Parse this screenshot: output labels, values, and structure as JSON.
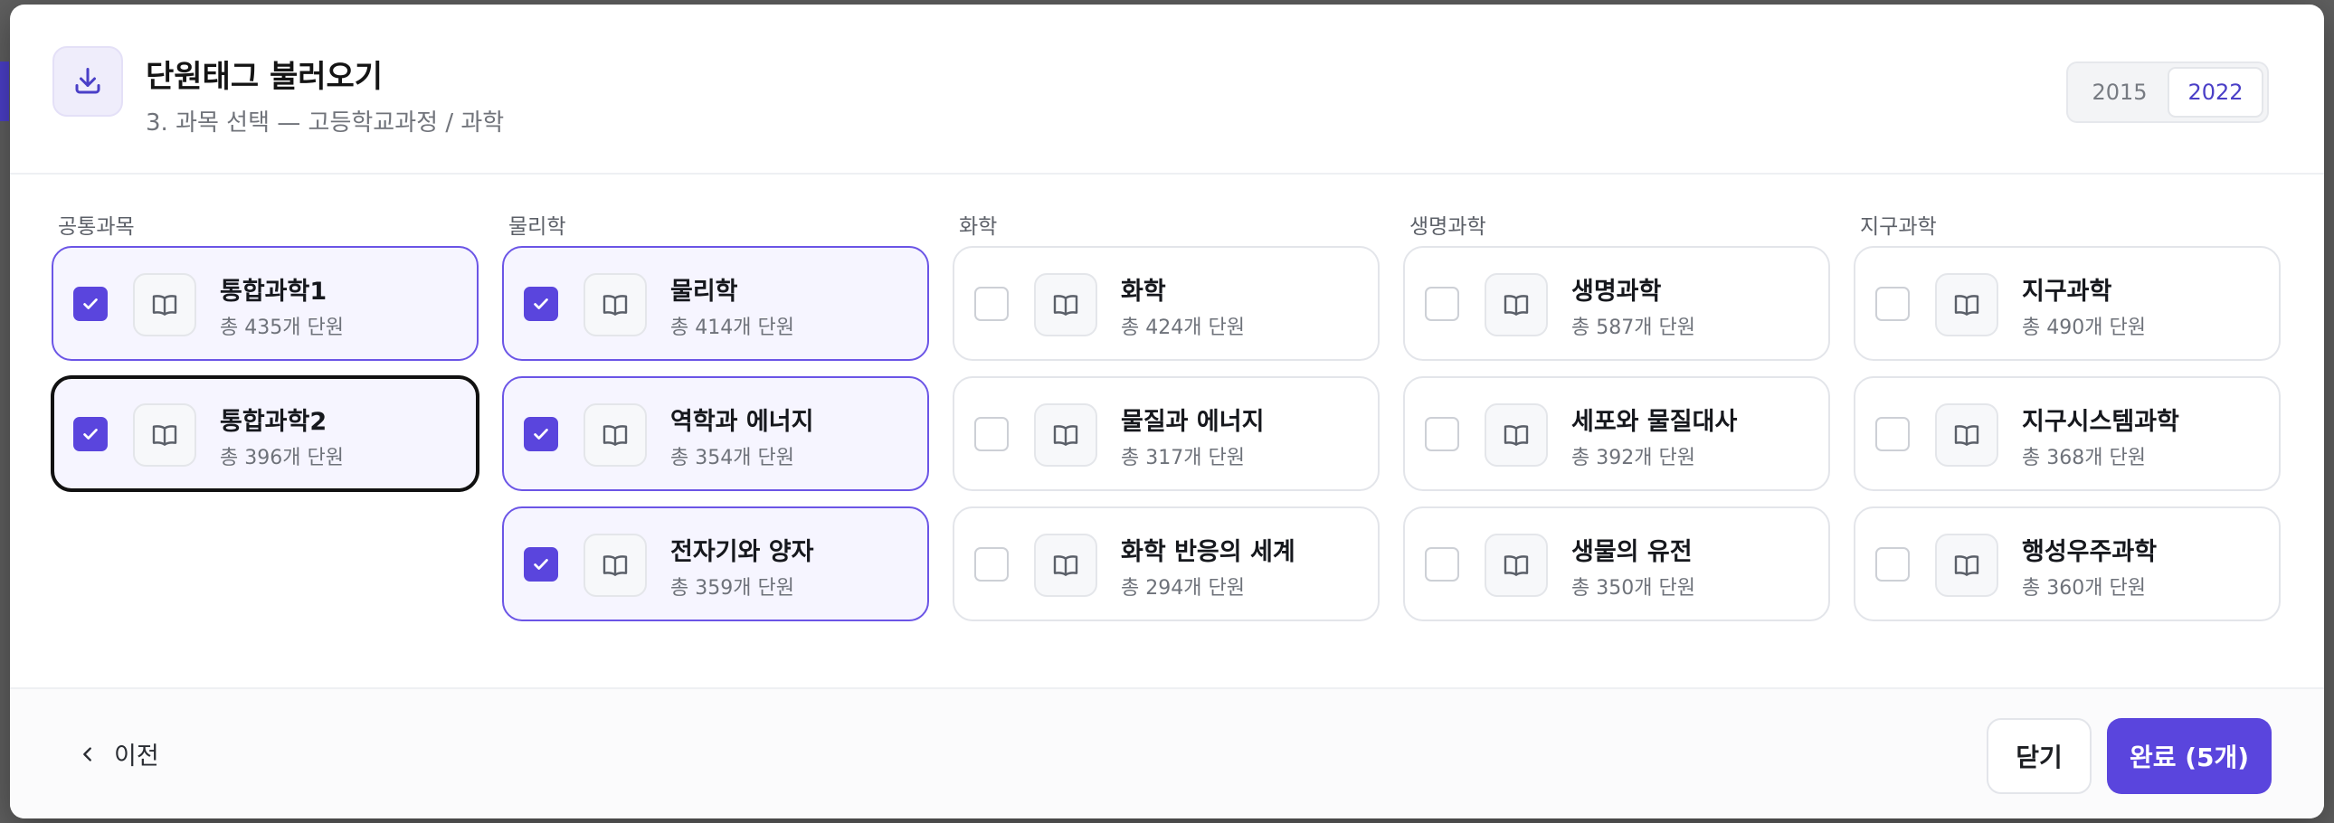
{
  "dialog": {
    "title": "단원태그 불러오기",
    "subtitle": "3. 과목 선택 — 고등학교과정 / 과학",
    "header_icon": "download-icon",
    "curriculum_years": [
      "2015",
      "2022"
    ],
    "selected_year": "2022"
  },
  "columns": [
    {
      "label": "공통과목",
      "subjects": [
        {
          "name": "통합과학1",
          "count_text": "총 435개 단원",
          "checked": true
        },
        {
          "name": "통합과학2",
          "count_text": "총 396개 단원",
          "checked": true
        }
      ]
    },
    {
      "label": "물리학",
      "subjects": [
        {
          "name": "물리학",
          "count_text": "총 414개 단원",
          "checked": true
        },
        {
          "name": "역학과 에너지",
          "count_text": "총 354개 단원",
          "checked": true
        },
        {
          "name": "전자기와 양자",
          "count_text": "총 359개 단원",
          "checked": true
        }
      ]
    },
    {
      "label": "화학",
      "subjects": [
        {
          "name": "화학",
          "count_text": "총 424개 단원",
          "checked": false
        },
        {
          "name": "물질과 에너지",
          "count_text": "총 317개 단원",
          "checked": false
        },
        {
          "name": "화학 반응의 세계",
          "count_text": "총 294개 단원",
          "checked": false
        }
      ]
    },
    {
      "label": "생명과학",
      "subjects": [
        {
          "name": "생명과학",
          "count_text": "총 587개 단원",
          "checked": false
        },
        {
          "name": "세포와 물질대사",
          "count_text": "총 392개 단원",
          "checked": false
        },
        {
          "name": "생물의 유전",
          "count_text": "총 350개 단원",
          "checked": false
        }
      ]
    },
    {
      "label": "지구과학",
      "subjects": [
        {
          "name": "지구과학",
          "count_text": "총 490개 단원",
          "checked": false
        },
        {
          "name": "지구시스템과학",
          "count_text": "총 368개 단원",
          "checked": false
        },
        {
          "name": "행성우주과학",
          "count_text": "총 360개 단원",
          "checked": false
        }
      ]
    }
  ],
  "footer": {
    "back_label": "이전",
    "close_label": "닫기",
    "done_label": "완료 (5개)"
  },
  "colors": {
    "accent": "#5a45dd",
    "accent_light_bg": "#f6f5ff",
    "border": "#e3e5ea"
  }
}
